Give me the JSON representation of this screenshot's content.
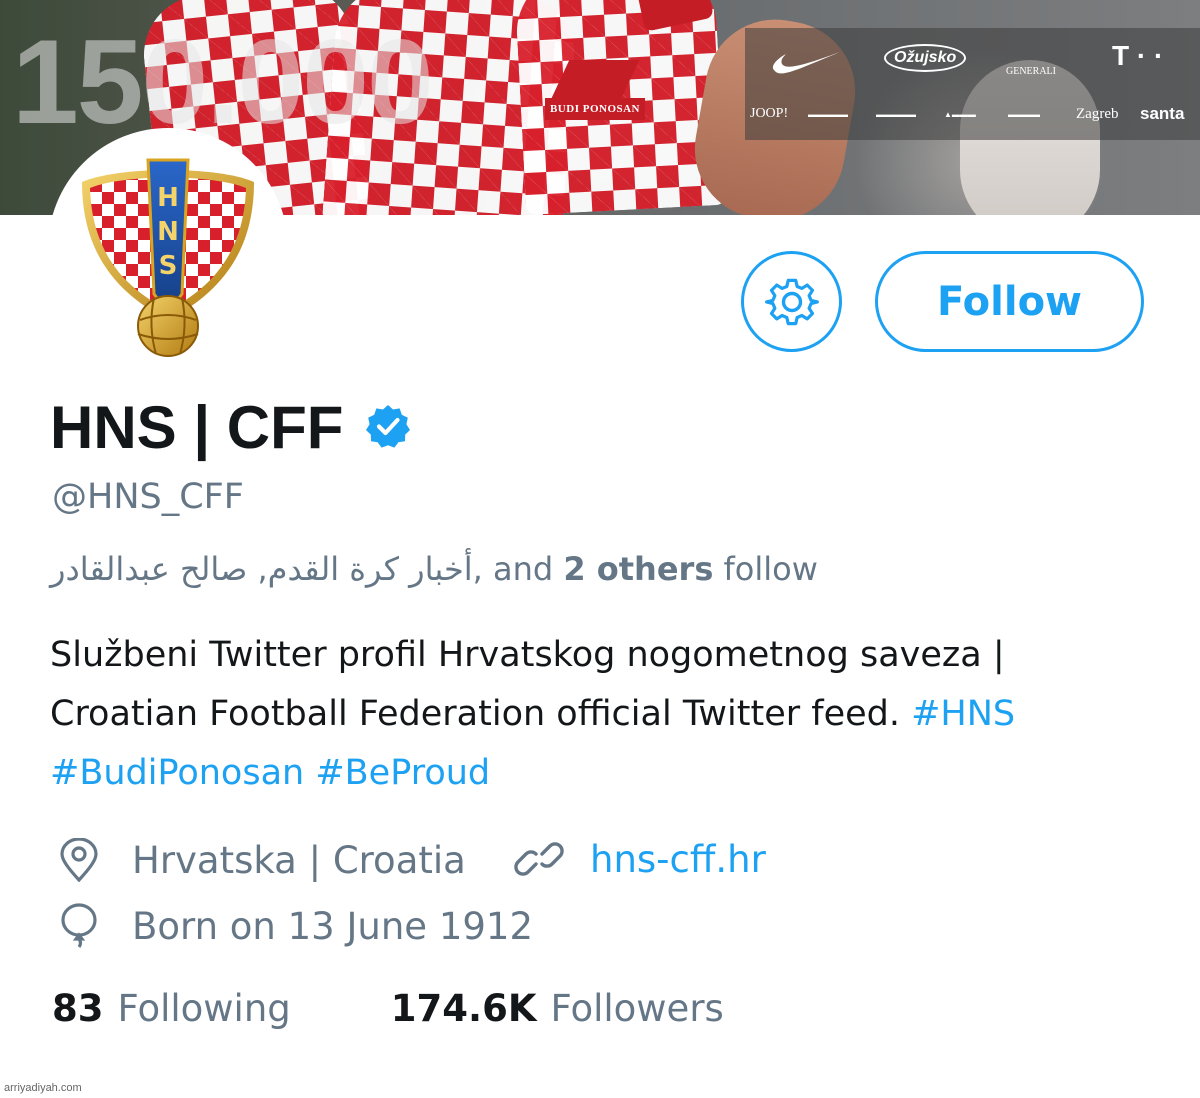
{
  "banner": {
    "big_number": "150.000",
    "slogan_badge": "BUDI PONOSAN",
    "sponsors": {
      "ozujsko": "Ožujsko",
      "generali": "GENERALI",
      "telekom": "T · ·",
      "joop": "JOOP!",
      "zagreb": "Zagreb",
      "santa": "santa"
    }
  },
  "profile": {
    "display_name": "HNS | CFF",
    "handle": "@HNS_CFF",
    "followed_by": {
      "names": "أخبار كرة القدم, صالح عبدالقادر",
      "middle": ", and ",
      "others": "2 others",
      "suffix": " follow"
    },
    "bio": {
      "text": "Službeni Twitter profil Hrvatskog nogometnog saveza | Croatian Football Federation official Twitter feed. ",
      "hashtags": [
        "#HNS",
        "#BudiPonosan",
        "#BeProud"
      ]
    },
    "location": "Hrvatska | Croatia",
    "website": "hns-cff.hr",
    "birth": "Born on 13 June 1912",
    "following_count": "83",
    "following_label": "Following",
    "followers_count": "174.6K",
    "followers_label": "Followers"
  },
  "actions": {
    "follow_label": "Follow"
  },
  "watermark": "arriyadiyah.com",
  "colors": {
    "accent": "#1da1f2",
    "secondary_text": "#657786",
    "primary_text": "#14171a",
    "crest_red": "#d8202c",
    "crest_blue": "#1f4e9c",
    "crest_gold": "#d9a520"
  }
}
